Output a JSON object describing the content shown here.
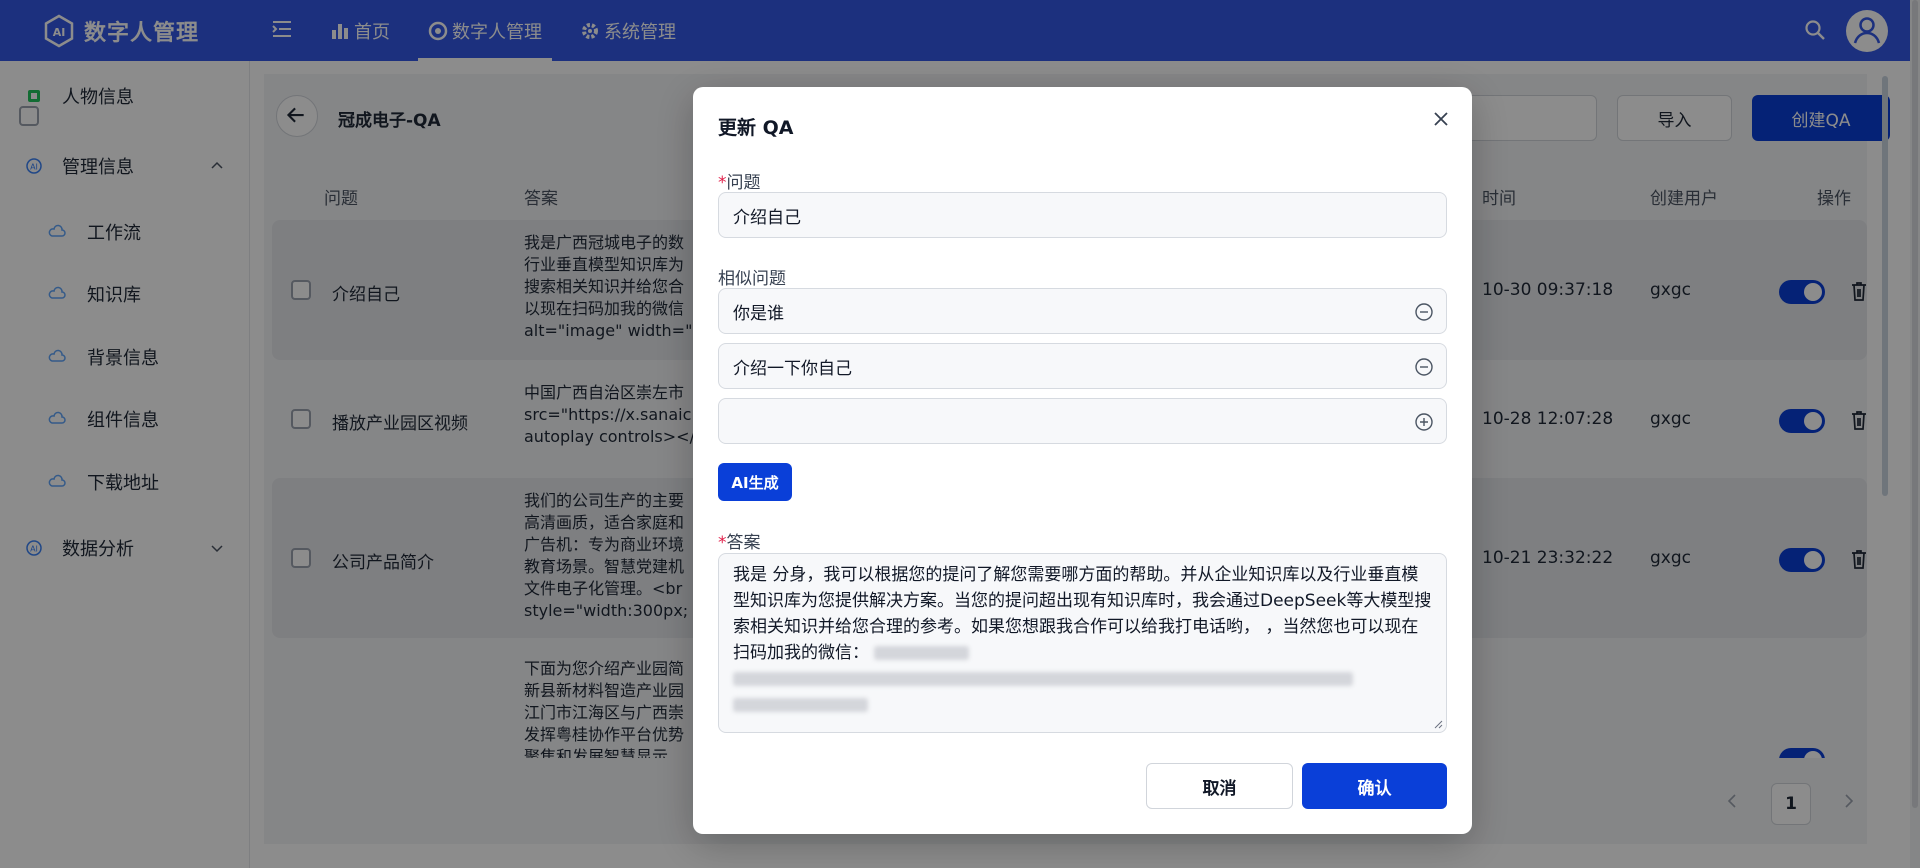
{
  "app": {
    "title": "数字人管理"
  },
  "nav": [
    {
      "label": "首页",
      "icon": "bar-chart-icon"
    },
    {
      "label": "数字人管理",
      "icon": "aperture-icon",
      "active": true
    },
    {
      "label": "系统管理",
      "icon": "gear-icon"
    }
  ],
  "sidebar": {
    "items": [
      {
        "label": "人物信息",
        "icon": "chip-icon"
      },
      {
        "label": "管理信息",
        "icon": "ai-icon",
        "expanded": true
      },
      {
        "label": "工作流",
        "icon": "cloud-icon"
      },
      {
        "label": "知识库",
        "icon": "cloud-icon"
      },
      {
        "label": "背景信息",
        "icon": "cloud-icon"
      },
      {
        "label": "组件信息",
        "icon": "cloud-icon"
      },
      {
        "label": "下载地址",
        "icon": "cloud-icon"
      },
      {
        "label": "数据分析",
        "icon": "ai-icon",
        "expanded": false
      }
    ]
  },
  "page": {
    "title": "冠成电子-QA",
    "import_label": "导入",
    "create_label": "创建QA"
  },
  "table": {
    "headers": {
      "question": "问题",
      "answer": "答案",
      "time": "时间",
      "user": "创建用户",
      "ops": "操作"
    },
    "rows": [
      {
        "question": "介绍自己",
        "answer": "我是广西冠城电子的数\n行业垂直模型知识库为\n搜索相关知识并给您合\n以现在扫码加我的微信\nalt=\"image\" width=\"",
        "time": "10-30 09:37:18",
        "user": "gxgc",
        "enabled": true
      },
      {
        "question": "播放产业园区视频",
        "answer": "中国广西自治区崇左市\nsrc=\"https://x.sanaic\nautoplay controls></",
        "time": "10-28 12:07:28",
        "user": "gxgc",
        "enabled": true
      },
      {
        "question": "公司产品简介",
        "answer": "我们的公司生产的主要\n高清画质，适合家庭和\n广告机：专为商业环境\n教育场景。智慧党建机\n文件电子化管理。<br\nstyle=\"width:300px;",
        "time": "10-21 23:32:22",
        "user": "gxgc",
        "enabled": true
      },
      {
        "question": "",
        "answer": "下面为您介绍产业园简\n新县新材料智造产业园\n江门市江海区与广西崇\n发挥粤桂协作平台优势\n聚焦和发展智慧显示",
        "time": "",
        "user": "",
        "enabled": true
      }
    ]
  },
  "pagination": {
    "current": "1"
  },
  "modal": {
    "title": "更新 QA",
    "question_label": "问题",
    "question_value": "介绍自己",
    "similar_label": "相似问题",
    "similar": [
      "你是谁",
      "介绍一下你自己",
      ""
    ],
    "ai_button": "AI生成",
    "answer_label": "答案",
    "answer_text": "我是                          分身，我可以根据您的提问了解您需要哪方面的帮助。并从企业知识库以及行业垂直模型知识库为您提供解决方案。当您的提问超出现有知识库时，我会通过DeepSeek等大模型搜索相关知识并给您合理的参考。如果您想跟我合作可以给我打电话哟，               ，当然您也可以现在扫码加我的微信：",
    "cancel_label": "取消",
    "confirm_label": "确认"
  },
  "colors": {
    "primary": "#0a3fd8",
    "topbar": "#3358e6"
  }
}
